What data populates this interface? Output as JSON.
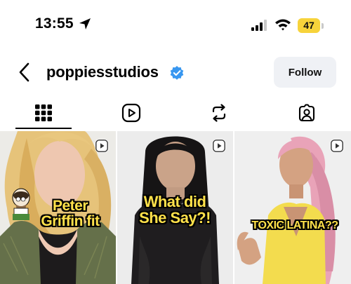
{
  "status_bar": {
    "time": "13:55",
    "battery": "47"
  },
  "profile": {
    "username": "poppiesstudios",
    "follow_label": "Follow"
  },
  "tabs": [
    {
      "name": "posts-grid",
      "icon": "grid-icon",
      "selected": true
    },
    {
      "name": "reels",
      "icon": "reels-play-icon",
      "selected": false
    },
    {
      "name": "reposts",
      "icon": "repost-icon",
      "selected": false
    },
    {
      "name": "tagged",
      "icon": "tagged-person-icon",
      "selected": false
    }
  ],
  "posts": [
    {
      "caption_line1": "Peter",
      "caption_line2": "Griffin fit"
    },
    {
      "caption_line1": "What did",
      "caption_line2": "She Say?!"
    },
    {
      "caption_line1": "TOXIC LATINA??"
    }
  ],
  "colors": {
    "verified": "#3897f0",
    "battery": "#f7d33b",
    "follow_bg": "#eff1f5",
    "caption": "#ffe14a"
  }
}
